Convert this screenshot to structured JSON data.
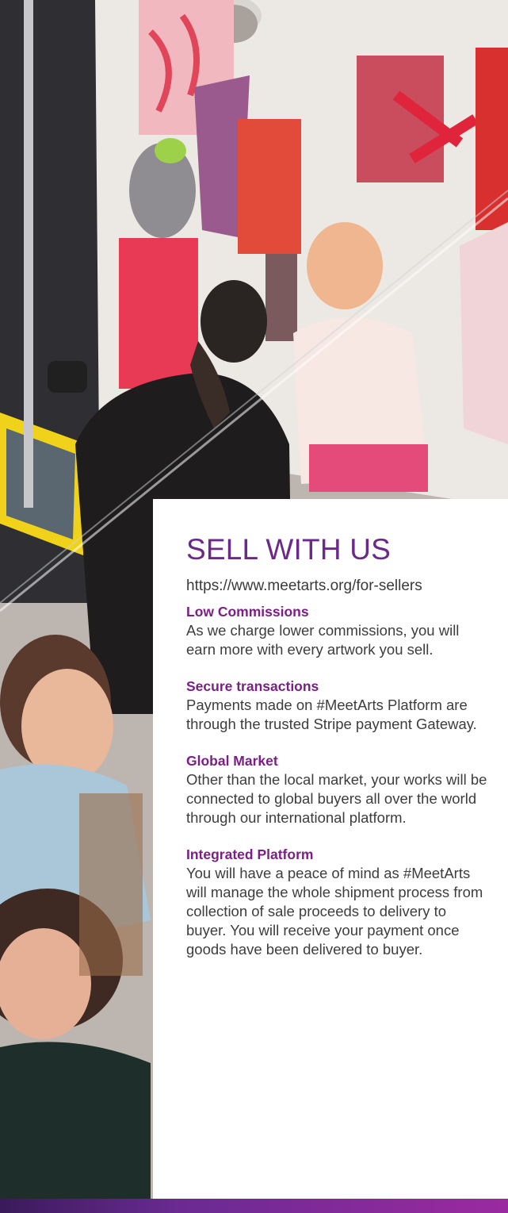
{
  "panel": {
    "title": "SELL WITH US",
    "url": "https://www.meetarts.org/for-sellers",
    "features": [
      {
        "title": "Low Commissions",
        "description": "As we charge lower commissions, you will earn more with every artwork you sell."
      },
      {
        "title": "Secure transactions",
        "description": "Payments made on #MeetArts Platform are through the trusted Stripe payment Gateway."
      },
      {
        "title": "Global Market",
        "description": "Other than the local market, your works will be connected to global buyers all over the world through our international platform."
      },
      {
        "title": "Integrated Platform",
        "description": "You will have a peace of mind as #MeetArts will manage the whole shipment process from collection of sale proceeds to delivery to buyer. You will receive your payment once goods have been delivered to buyer."
      }
    ]
  },
  "colors": {
    "title": "#6b2a87",
    "feature_title": "#7b1f87",
    "body_text": "#3d3d3d",
    "panel_background": "#ffffff",
    "bottom_bar": "#6a2a92"
  }
}
